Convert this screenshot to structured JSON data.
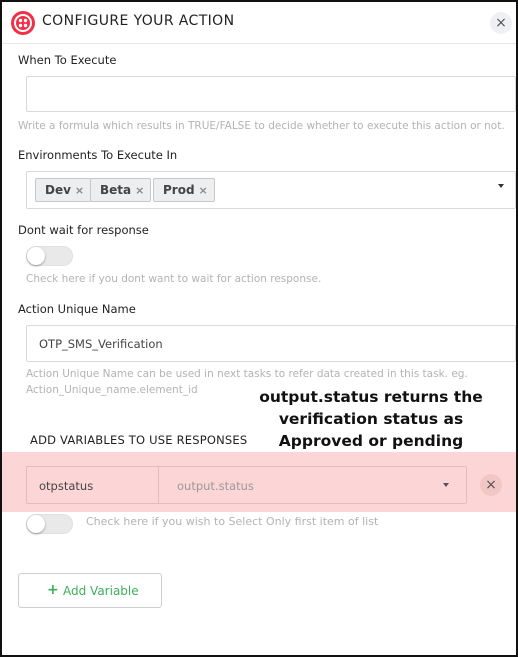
{
  "header": {
    "title": "CONFIGURE YOUR ACTION",
    "close_icon": "close-icon",
    "logo": "twilio-logo"
  },
  "when_to_execute": {
    "label": "When To Execute",
    "value": "",
    "help": "Write a formula which results in TRUE/FALSE to decide whether to execute this action or not."
  },
  "environments": {
    "label": "Environments To Execute In",
    "tags": [
      "Dev",
      "Beta",
      "Prod"
    ],
    "remove_glyph": "×"
  },
  "dont_wait": {
    "label": "Dont wait for response",
    "checked": false,
    "help": "Check here if you dont want to wait for action response."
  },
  "unique_name": {
    "label": "Action Unique Name",
    "value": "OTP_SMS_Verification",
    "help_line1": "Action Unique Name can be used in next tasks to refer data created in this task. eg.",
    "help_line2": "Action_Unique_name.element_id"
  },
  "annotation": {
    "line1": "output.status returns the",
    "line2": "verification status as",
    "line3": "Approved or pending"
  },
  "variables": {
    "section_title": "ADD VARIABLES TO USE RESPONSES",
    "rows": [
      {
        "name": "otpstatus",
        "value": "output.status"
      }
    ],
    "first_item_help": "Check here if you wish to Select Only first item of list",
    "first_item_checked": false,
    "add_label": "Add Variable",
    "add_glyph": "+",
    "remove_glyph": "×"
  },
  "colors": {
    "brand": "#f22f46",
    "highlight": "#fcd6d6",
    "add_green": "#3fae5b"
  }
}
